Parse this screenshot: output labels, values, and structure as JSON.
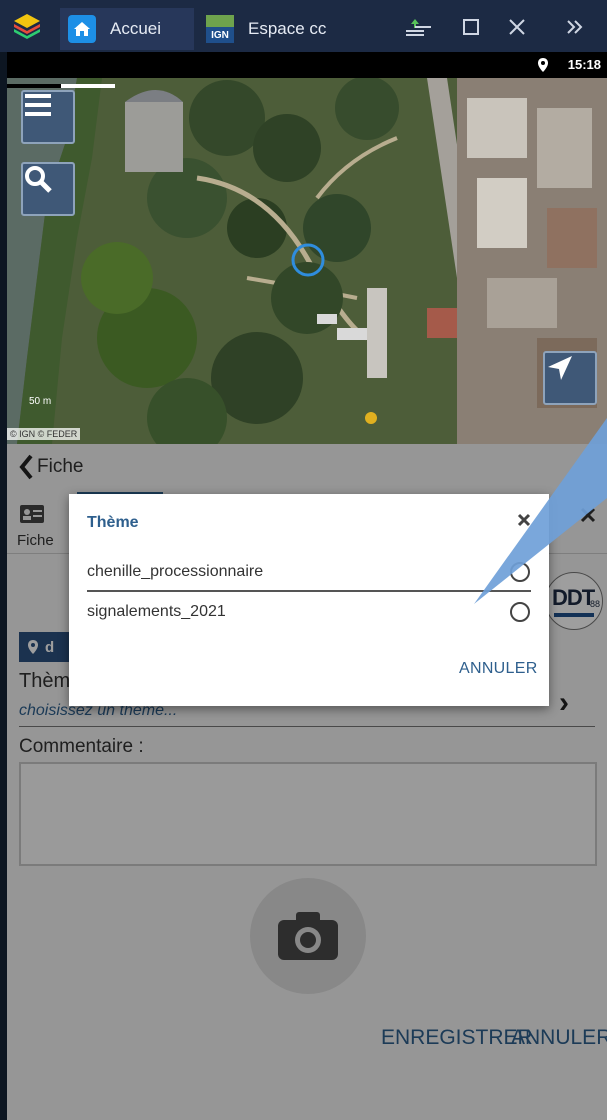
{
  "emulator": {
    "tabs": [
      {
        "label": "Accuei",
        "icon": "home-icon"
      },
      {
        "label": "Espace cc",
        "icon": "ign-app-icon",
        "icon_text": "IGN"
      }
    ],
    "controls": [
      "upload-icon",
      "minimize-icon",
      "maximize-icon",
      "close-icon",
      "more-icon"
    ]
  },
  "statusbar": {
    "time": "15:18",
    "icon": "location-pin-icon"
  },
  "map": {
    "buttons": [
      "menu-icon",
      "search-icon",
      "navigate-arrow-icon"
    ],
    "scale_label": "50 m",
    "attribution": "© IGN © FEDER"
  },
  "form": {
    "back_label": "Fiche",
    "tab_label": "Fiche",
    "location_chip": "d",
    "theme_label": "Thèm",
    "theme_placeholder": "choisissez un theme...",
    "comment_label": "Commentaire :",
    "save_button": "ENREGISTRER",
    "cancel_button": "ANNULER",
    "logo_text": "DDT",
    "logo_sub": "88"
  },
  "dialog": {
    "title": "Thème",
    "options": [
      {
        "label": "chenille_processionnaire",
        "selected": false
      },
      {
        "label": "signalements_2021",
        "selected": false
      }
    ],
    "cancel_label": "ANNULER"
  },
  "colors": {
    "accent": "#2e5f8d",
    "titlebar": "#1c2a44",
    "map_button": "#3f5877",
    "callout": "#6fa0d8"
  }
}
